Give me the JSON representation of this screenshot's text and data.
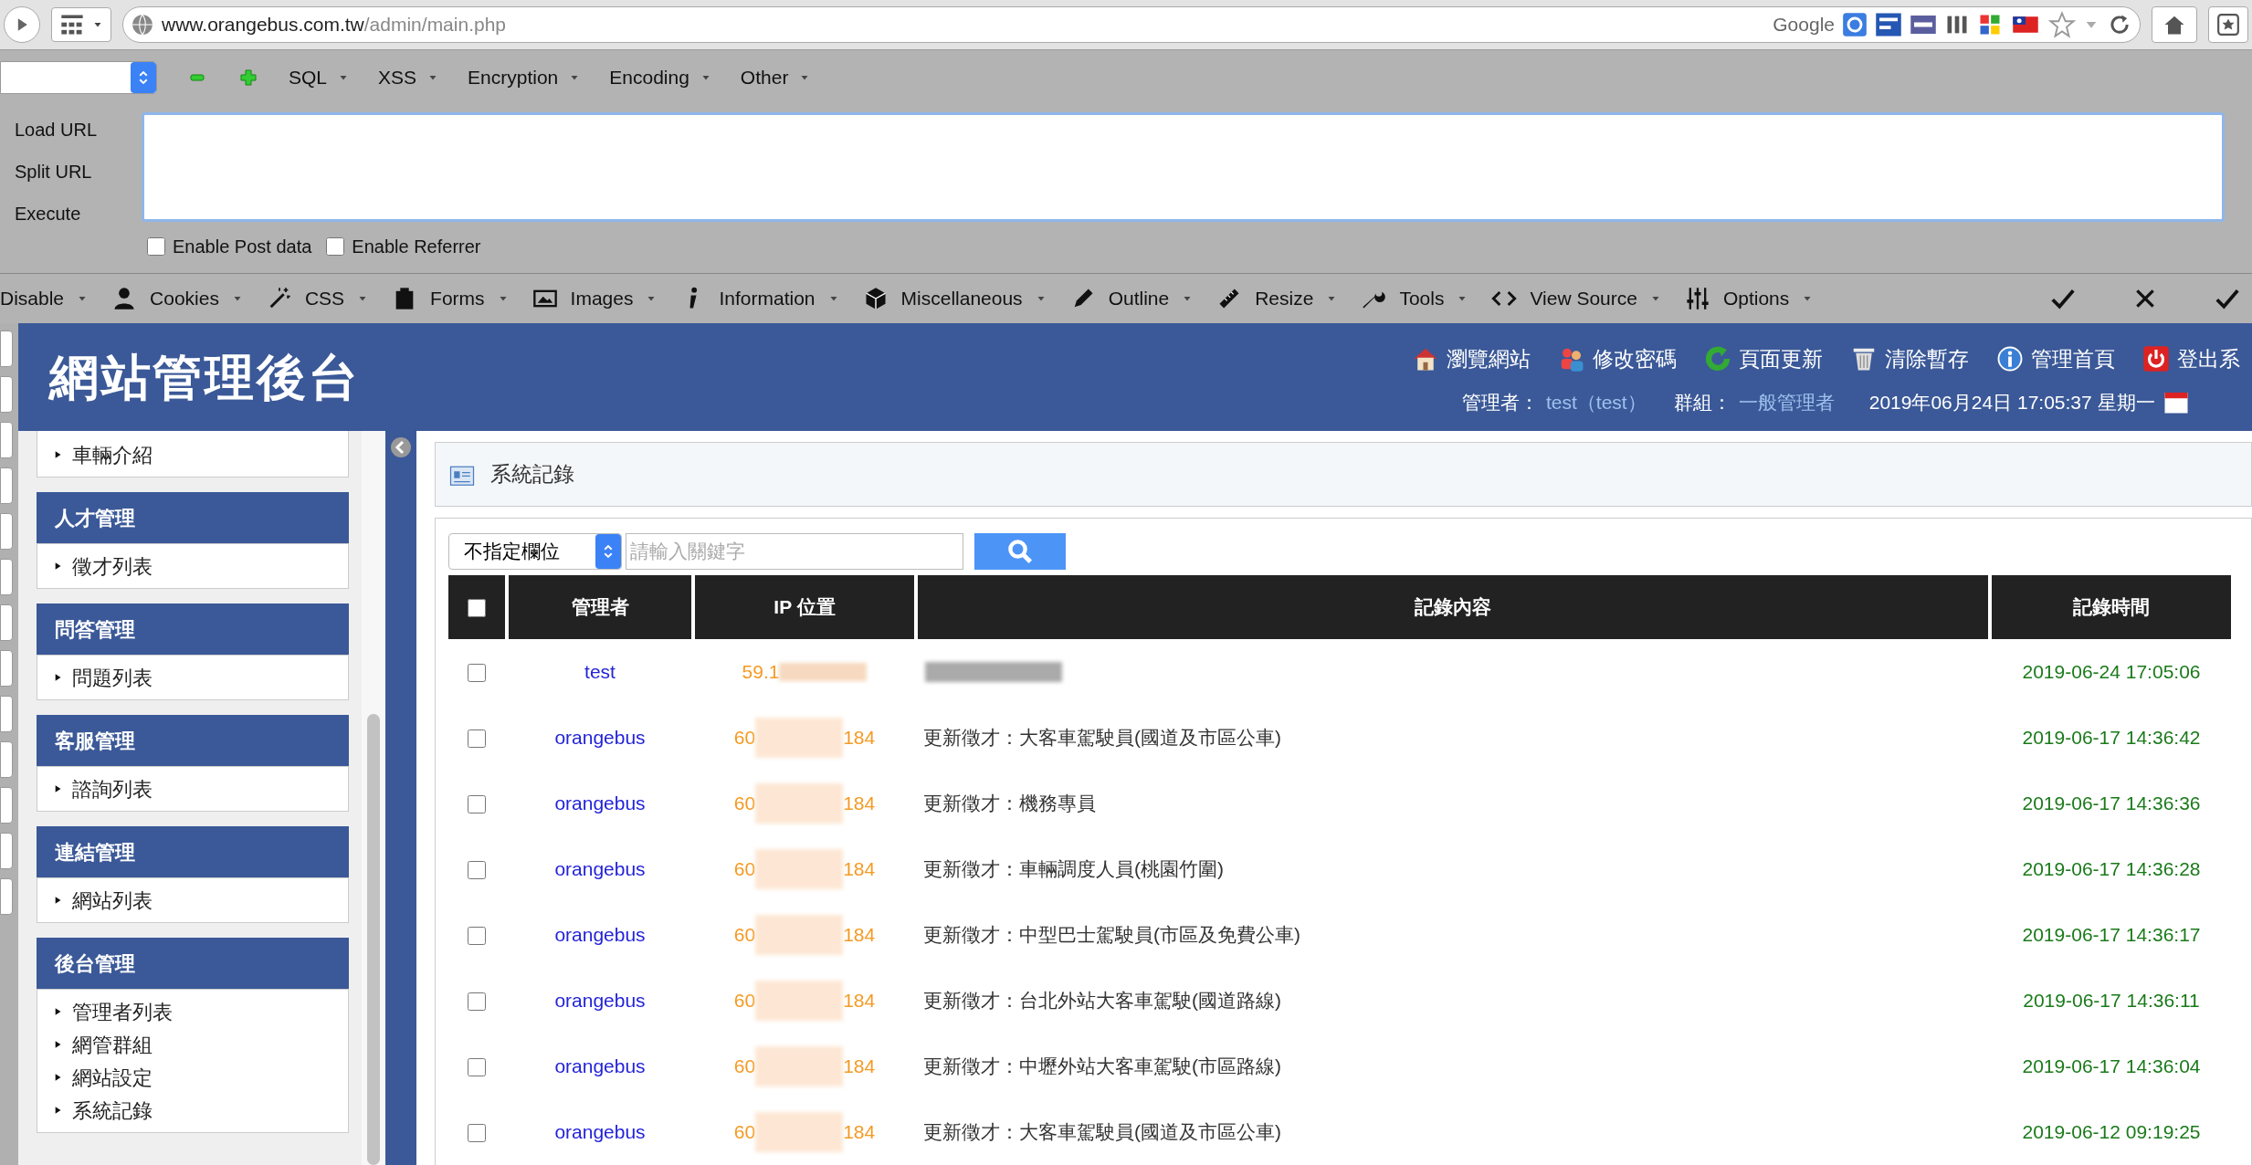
{
  "browser": {
    "url_host": "www.orangebus.com.tw",
    "url_path": "/admin/main.php",
    "search_engine": "Google"
  },
  "hackbar": {
    "menus": [
      "SQL",
      "XSS",
      "Encryption",
      "Encoding",
      "Other"
    ],
    "actions": [
      "Load URL",
      "Split URL",
      "Execute"
    ],
    "options": [
      {
        "label": "Enable Post data",
        "checked": false
      },
      {
        "label": "Enable Referrer",
        "checked": false
      }
    ]
  },
  "toolbar": [
    "Disable",
    "Cookies",
    "CSS",
    "Forms",
    "Images",
    "Information",
    "Miscellaneous",
    "Outline",
    "Resize",
    "Tools",
    "View Source",
    "Options"
  ],
  "header": {
    "title": "網站管理後台",
    "links": [
      "瀏覽網站",
      "修改密碼",
      "頁面更新",
      "清除暫存",
      "管理首頁",
      "登出系"
    ],
    "user_label": "管理者：",
    "user": "test（test）",
    "group_label": "群組：",
    "group": "一般管理者",
    "datetime": "2019年06月24日 17:05:37 星期一"
  },
  "sidebar": [
    {
      "items": [
        "車輛介紹"
      ]
    },
    {
      "title": "人才管理",
      "items": [
        "徵才列表"
      ]
    },
    {
      "title": "問答管理",
      "items": [
        "問題列表"
      ]
    },
    {
      "title": "客服管理",
      "items": [
        "諮詢列表"
      ]
    },
    {
      "title": "連結管理",
      "items": [
        "網站列表"
      ]
    },
    {
      "title": "後台管理",
      "items": [
        "管理者列表",
        "網管群組",
        "網站設定",
        "系統記錄"
      ]
    }
  ],
  "panel": {
    "title": "系統記錄",
    "filter": "不指定欄位",
    "placeholder": "請輸入關鍵字"
  },
  "table": {
    "select_all_checked": false,
    "columns": [
      "管理者",
      "IP 位置",
      "記錄內容",
      "記錄時間"
    ],
    "rows": [
      {
        "user": "test",
        "ip_start": "59.1",
        "time": "2019-06-24 17:05:06",
        "checked": false
      },
      {
        "user": "orangebus",
        "ip_start": "60",
        "ip_end": "184",
        "content": "更新徵才：大客車駕駛員(國道及市區公車)",
        "time": "2019-06-17 14:36:42",
        "checked": false
      },
      {
        "user": "orangebus",
        "ip_start": "60",
        "ip_end": "184",
        "content": "更新徵才：機務專員",
        "time": "2019-06-17 14:36:36",
        "checked": false
      },
      {
        "user": "orangebus",
        "ip_start": "60",
        "ip_end": "184",
        "content": "更新徵才：車輛調度人員(桃園竹圍)",
        "time": "2019-06-17 14:36:28",
        "checked": false
      },
      {
        "user": "orangebus",
        "ip_start": "60",
        "ip_end": "184",
        "content": "更新徵才：中型巴士駕駛員(市區及免費公車)",
        "time": "2019-06-17 14:36:17",
        "checked": false
      },
      {
        "user": "orangebus",
        "ip_start": "60",
        "ip_end": "184",
        "content": "更新徵才：台北外站大客車駕駛(國道路線)",
        "time": "2019-06-17 14:36:11",
        "checked": false
      },
      {
        "user": "orangebus",
        "ip_start": "60",
        "ip_end": "184",
        "content": "更新徵才：中壢外站大客車駕駛(市區路線)",
        "time": "2019-06-17 14:36:04",
        "checked": false
      },
      {
        "user": "orangebus",
        "ip_start": "60",
        "ip_end": "184",
        "content": "更新徵才：大客車駕駛員(國道及市區公車)",
        "time": "2019-06-12 09:19:25",
        "checked": false
      }
    ]
  }
}
